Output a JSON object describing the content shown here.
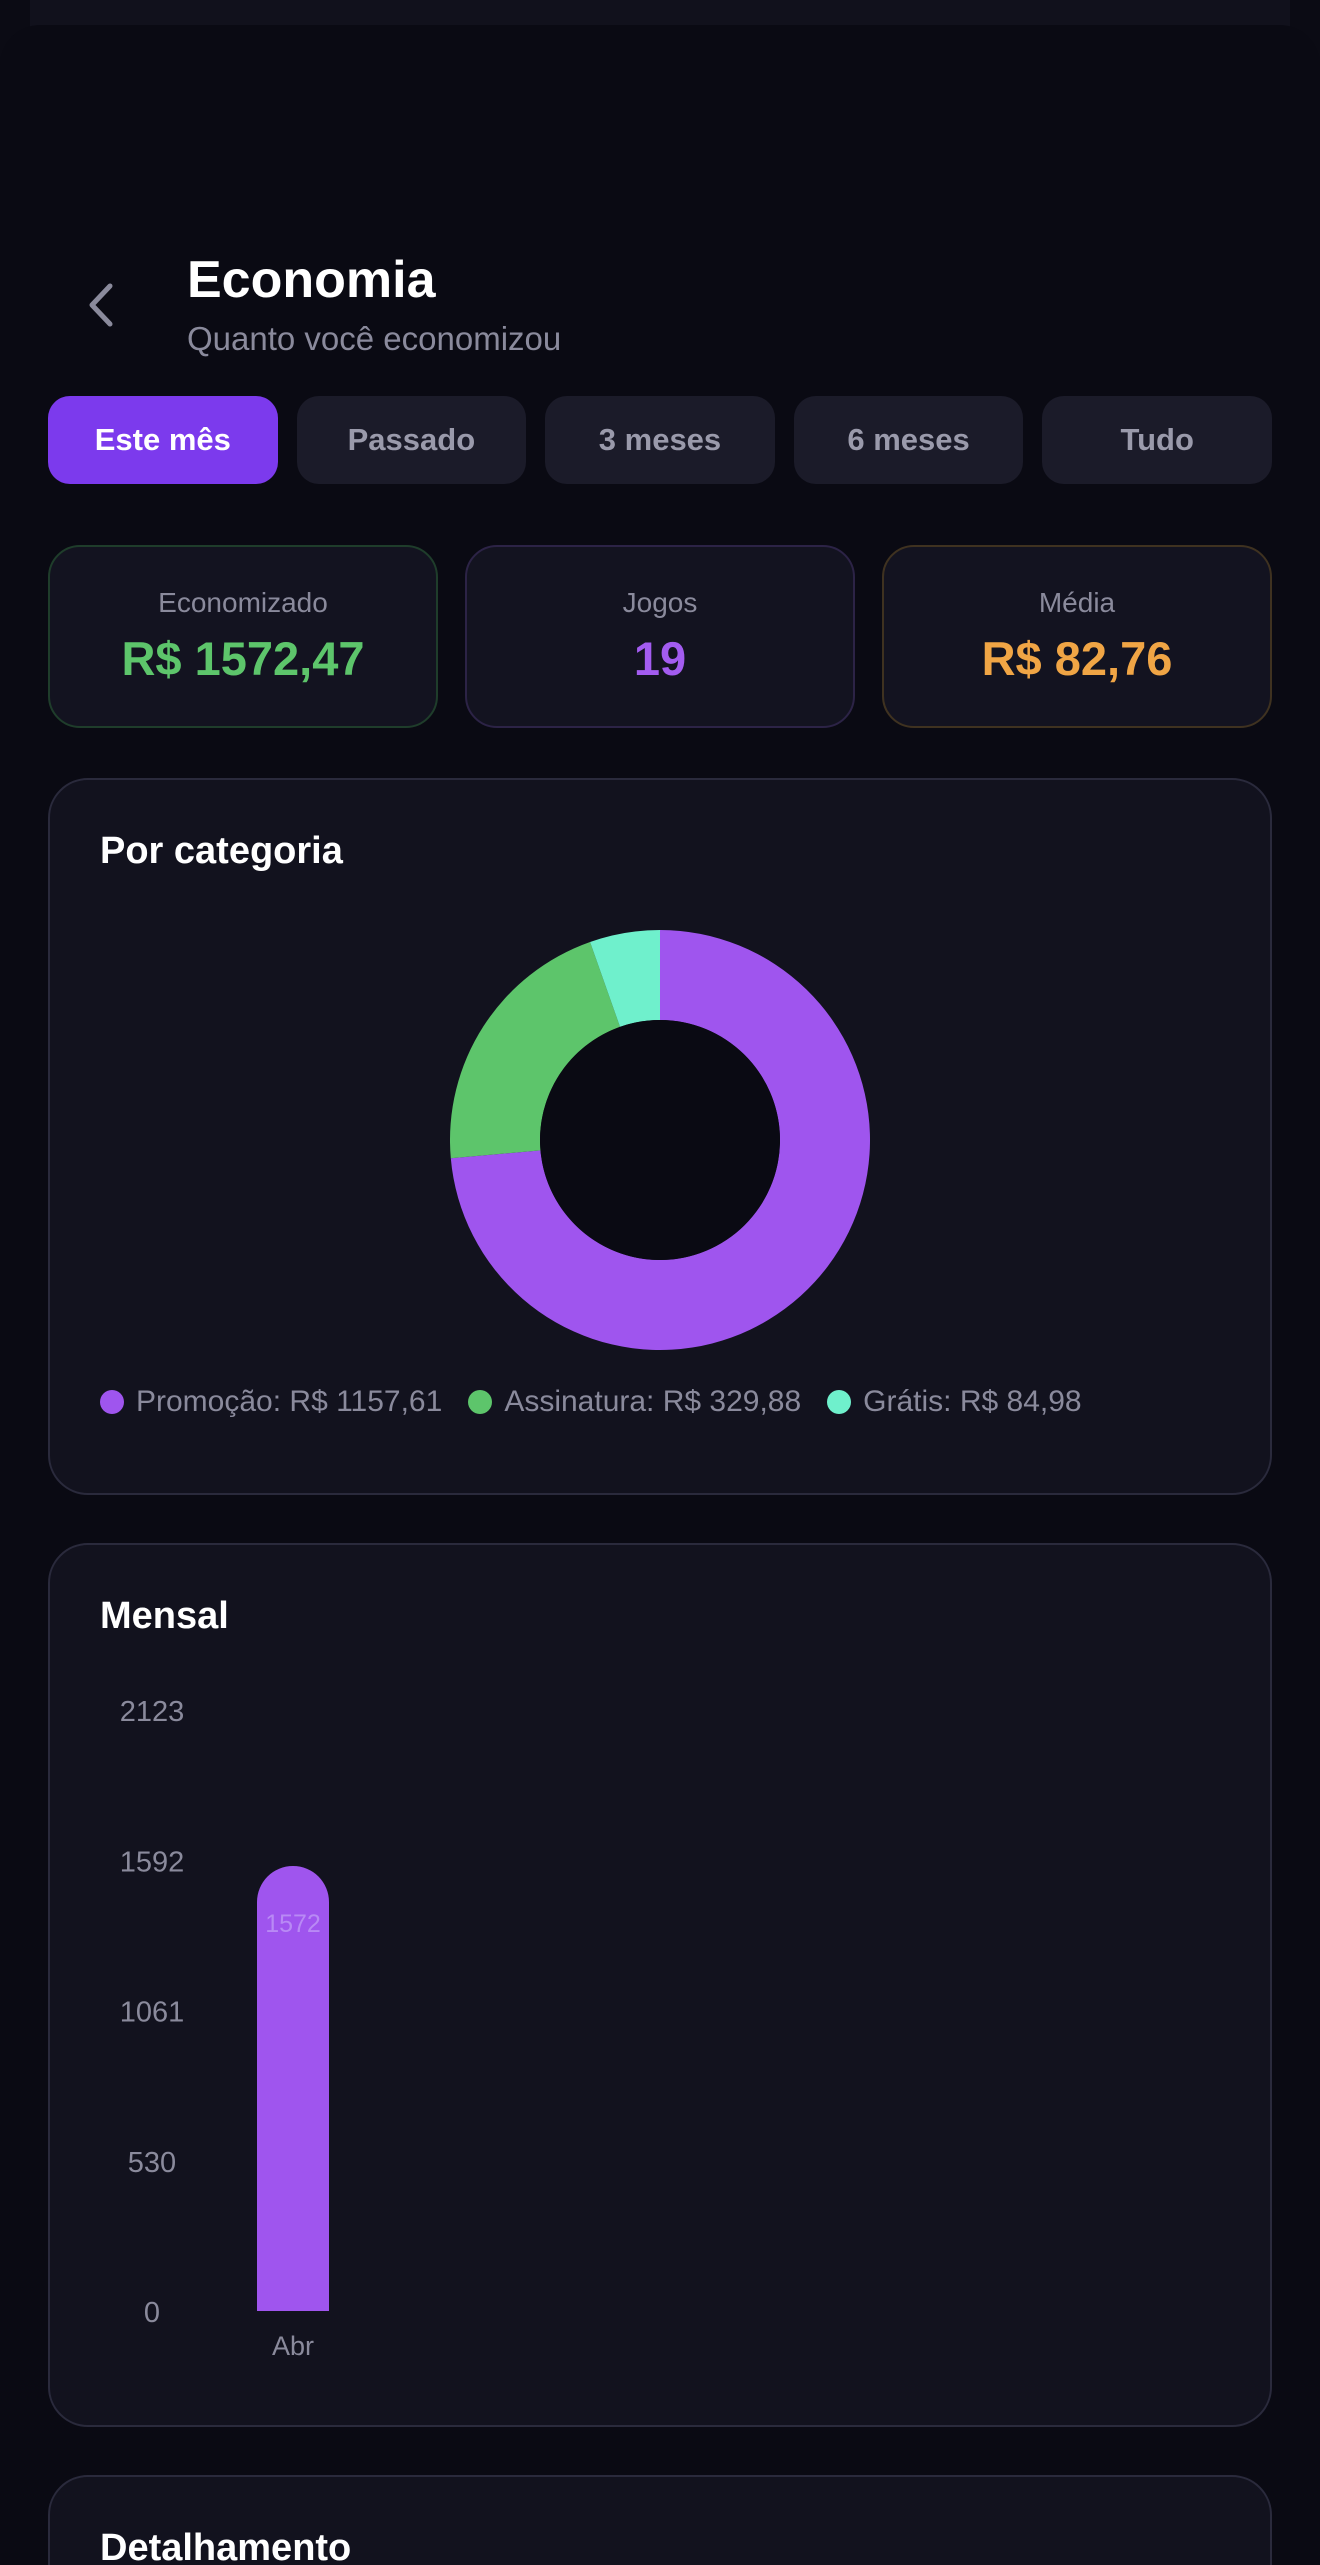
{
  "header": {
    "title": "Economia",
    "subtitle": "Quanto você economizou"
  },
  "tabs": [
    {
      "label": "Este mês",
      "active": true
    },
    {
      "label": "Passado",
      "active": false
    },
    {
      "label": "3 meses",
      "active": false
    },
    {
      "label": "6 meses",
      "active": false
    },
    {
      "label": "Tudo",
      "active": false
    }
  ],
  "stats": {
    "saved": {
      "label": "Economizado",
      "value": "R$ 1572,47"
    },
    "games": {
      "label": "Jogos",
      "value": "19"
    },
    "average": {
      "label": "Média",
      "value": "R$ 82,76"
    }
  },
  "category_card": {
    "title": "Por categoria",
    "legend": [
      {
        "text": "Promoção: R$ 1157,61",
        "color": "#9f55ee"
      },
      {
        "text": "Assinatura: R$ 329,88",
        "color": "#5dc56b"
      },
      {
        "text": "Grátis: R$ 84,98",
        "color": "#6ff0cc"
      }
    ]
  },
  "monthly_card": {
    "title": "Mensal"
  },
  "details_card": {
    "title": "Detalhamento"
  },
  "colors": {
    "accent": "#7c3aed",
    "purple": "#9f55ee",
    "green": "#5dc56b",
    "teal": "#6ff0cc",
    "orange": "#f0a545"
  },
  "chart_data": [
    {
      "type": "pie",
      "title": "Por categoria",
      "categories": [
        "Promoção",
        "Assinatura",
        "Grátis"
      ],
      "values": [
        1157.61,
        329.88,
        84.98
      ],
      "colors": [
        "#9f55ee",
        "#5dc56b",
        "#6ff0cc"
      ],
      "donut": true
    },
    {
      "type": "bar",
      "title": "Mensal",
      "categories": [
        "Abr"
      ],
      "values": [
        1572
      ],
      "data_labels": [
        "1572"
      ],
      "yticks": [
        0,
        530,
        1061,
        1592,
        2123
      ],
      "ylim": [
        0,
        2123
      ],
      "color": "#9f55ee",
      "grid": false
    }
  ]
}
